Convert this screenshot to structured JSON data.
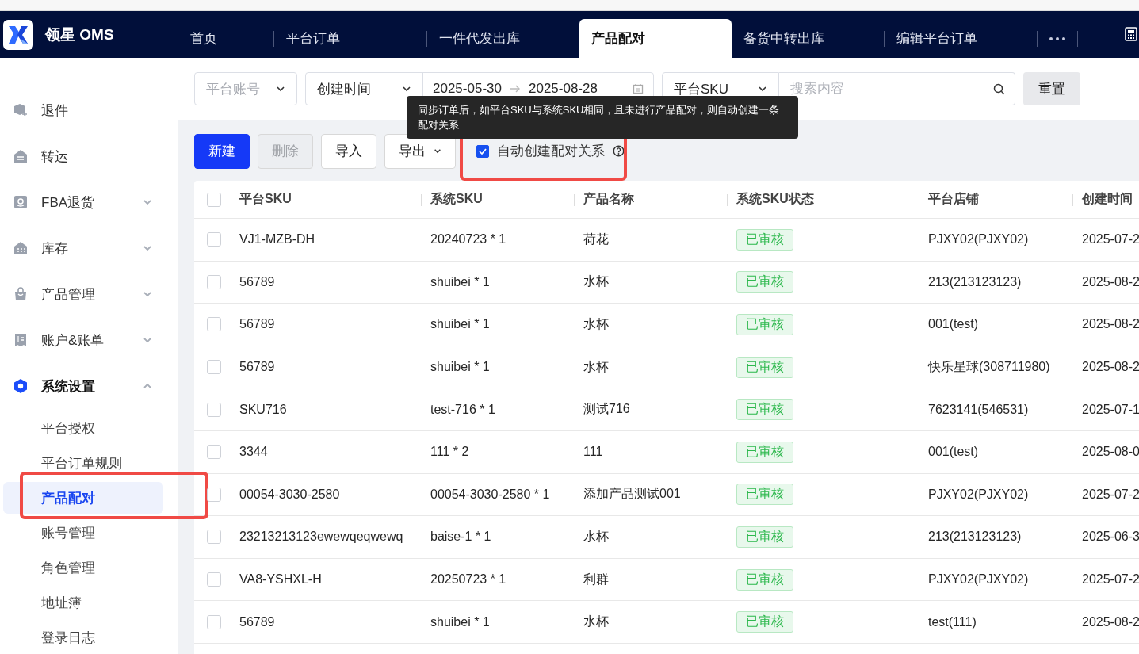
{
  "app": {
    "logo_text": "领星 OMS"
  },
  "top_tabs": [
    {
      "label": "首页",
      "selected": false
    },
    {
      "label": "平台订单",
      "selected": false
    },
    {
      "label": "一件代发出库",
      "selected": false
    },
    {
      "label": "产品配对",
      "selected": true
    },
    {
      "label": "备货中转出库",
      "selected": false
    },
    {
      "label": "编辑平台订单",
      "selected": false
    }
  ],
  "sidebar": {
    "items": [
      {
        "label": "退件",
        "active": false
      },
      {
        "label": "转运",
        "active": false
      },
      {
        "label": "FBA退货",
        "expanded": false,
        "active": false
      },
      {
        "label": "库存",
        "expanded": false,
        "active": false
      },
      {
        "label": "产品管理",
        "expanded": false,
        "active": false
      },
      {
        "label": "账户&账单",
        "expanded": false,
        "active": false
      },
      {
        "label": "系统设置",
        "expanded": true,
        "active": true,
        "children": [
          {
            "label": "平台授权",
            "selected": false
          },
          {
            "label": "平台订单规则",
            "selected": false
          },
          {
            "label": "产品配对",
            "selected": true
          },
          {
            "label": "账号管理",
            "selected": false
          },
          {
            "label": "角色管理",
            "selected": false
          },
          {
            "label": "地址簿",
            "selected": false
          },
          {
            "label": "登录日志",
            "selected": false
          }
        ]
      }
    ]
  },
  "filters": {
    "account": {
      "placeholder": "平台账号"
    },
    "date_type": "创建时间",
    "date_start": "2025-05-30",
    "date_end": "2025-08-28",
    "field_type": "平台SKU",
    "search": {
      "placeholder": "搜索内容"
    },
    "reset": "重置"
  },
  "toolbar": {
    "buttons": [
      {
        "label": "新建",
        "kind": "primary"
      },
      {
        "label": "删除",
        "kind": "disabled"
      },
      {
        "label": "导入",
        "kind": "default"
      },
      {
        "label": "导出",
        "kind": "dropdown"
      }
    ],
    "auto_create": {
      "label": "自动创建配对关系",
      "checked": true
    },
    "tooltip": "同步订单后，如平台SKU与系统SKU相同，且未进行产品配对，则自动创建一条配对关系"
  },
  "table": {
    "all_checked": false,
    "columns": [
      "平台SKU",
      "系统SKU",
      "产品名称",
      "系统SKU状态",
      "平台店铺",
      "创建时间"
    ],
    "rows": [
      {
        "checked": false,
        "cells": [
          "VJ1-MZB-DH",
          "20240723 * 1",
          "荷花",
          "已审核",
          "PJXY02(PJXY02)",
          "2025-07-2"
        ]
      },
      {
        "checked": false,
        "cells": [
          "56789",
          "shuibei * 1",
          "水杯",
          "已审核",
          "213(213123123)",
          "2025-08-2"
        ]
      },
      {
        "checked": false,
        "cells": [
          "56789",
          "shuibei * 1",
          "水杯",
          "已审核",
          "001(test)",
          "2025-08-2"
        ]
      },
      {
        "checked": false,
        "cells": [
          "56789",
          "shuibei * 1",
          "水杯",
          "已审核",
          "快乐星球(308711980)",
          "2025-08-2"
        ]
      },
      {
        "checked": false,
        "cells": [
          "SKU716",
          "test-716 * 1",
          "测试716",
          "已审核",
          "7623141(546531)",
          "2025-07-1"
        ]
      },
      {
        "checked": false,
        "cells": [
          "3344",
          "111 * 2",
          "111",
          "已审核",
          "001(test)",
          "2025-08-0"
        ]
      },
      {
        "checked": false,
        "cells": [
          "00054-3030-2580",
          "00054-3030-2580 * 1",
          "添加产品测试001",
          "已审核",
          "PJXY02(PJXY02)",
          "2025-07-2"
        ]
      },
      {
        "checked": false,
        "cells": [
          "23213213123ewewqeqwewq",
          "baise-1 * 1",
          "水杯",
          "已审核",
          "213(213123123)",
          "2025-06-3"
        ]
      },
      {
        "checked": false,
        "cells": [
          "VA8-YSHXL-H",
          "20250723 * 1",
          "利群",
          "已审核",
          "PJXY02(PJXY02)",
          "2025-07-2"
        ]
      },
      {
        "checked": false,
        "cells": [
          "56789",
          "shuibei * 1",
          "水杯",
          "已审核",
          "test(111)",
          "2025-08-2"
        ]
      }
    ]
  }
}
